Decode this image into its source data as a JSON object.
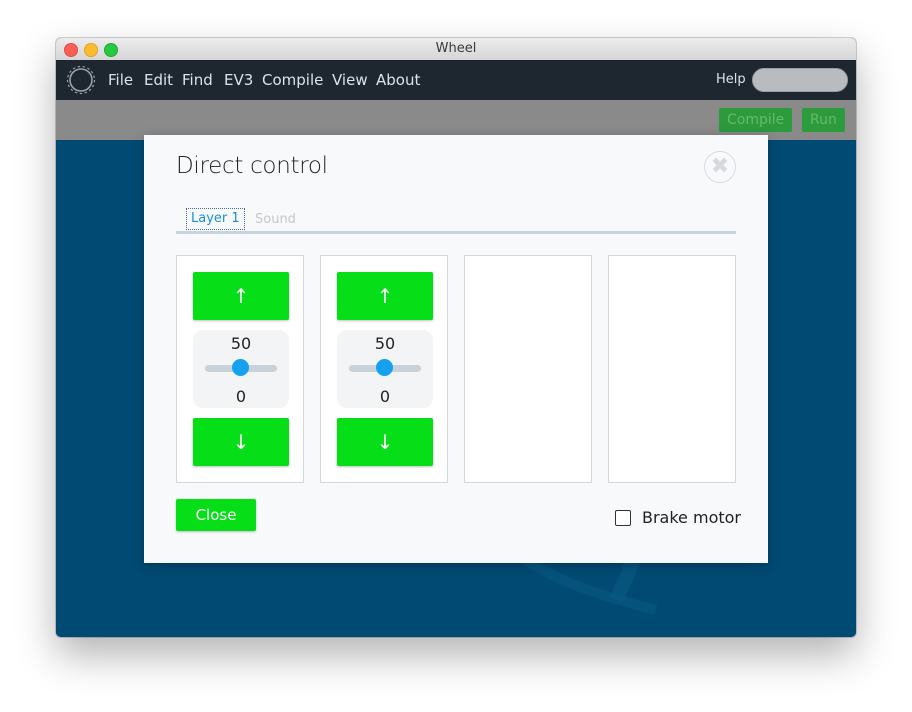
{
  "window": {
    "title": "Wheel"
  },
  "menubar": {
    "items": [
      "File",
      "Edit",
      "Find",
      "EV3",
      "Compile",
      "View",
      "About"
    ],
    "help_label": "Help"
  },
  "toolbar": {
    "compile_label": "Compile",
    "run_label": "Run"
  },
  "dialog": {
    "title": "Direct control",
    "close_icon": "close-circle-icon",
    "tabs": [
      {
        "label": "Layer 1",
        "active": true
      },
      {
        "label": "Sound",
        "active": false
      }
    ],
    "motors": [
      {
        "up_label": "↑",
        "down_label": "↓",
        "speed": "50",
        "position": "0",
        "slider_value": 50
      },
      {
        "up_label": "↑",
        "down_label": "↓",
        "speed": "50",
        "position": "0",
        "slider_value": 50
      }
    ],
    "close_button_label": "Close",
    "brake_motor_label": "Brake motor",
    "brake_motor_checked": false
  },
  "colors": {
    "accent_green": "#06df18",
    "canvas_blue": "#004a73",
    "tab_active": "#1a8fd8",
    "slider_thumb": "#16a1ef"
  }
}
